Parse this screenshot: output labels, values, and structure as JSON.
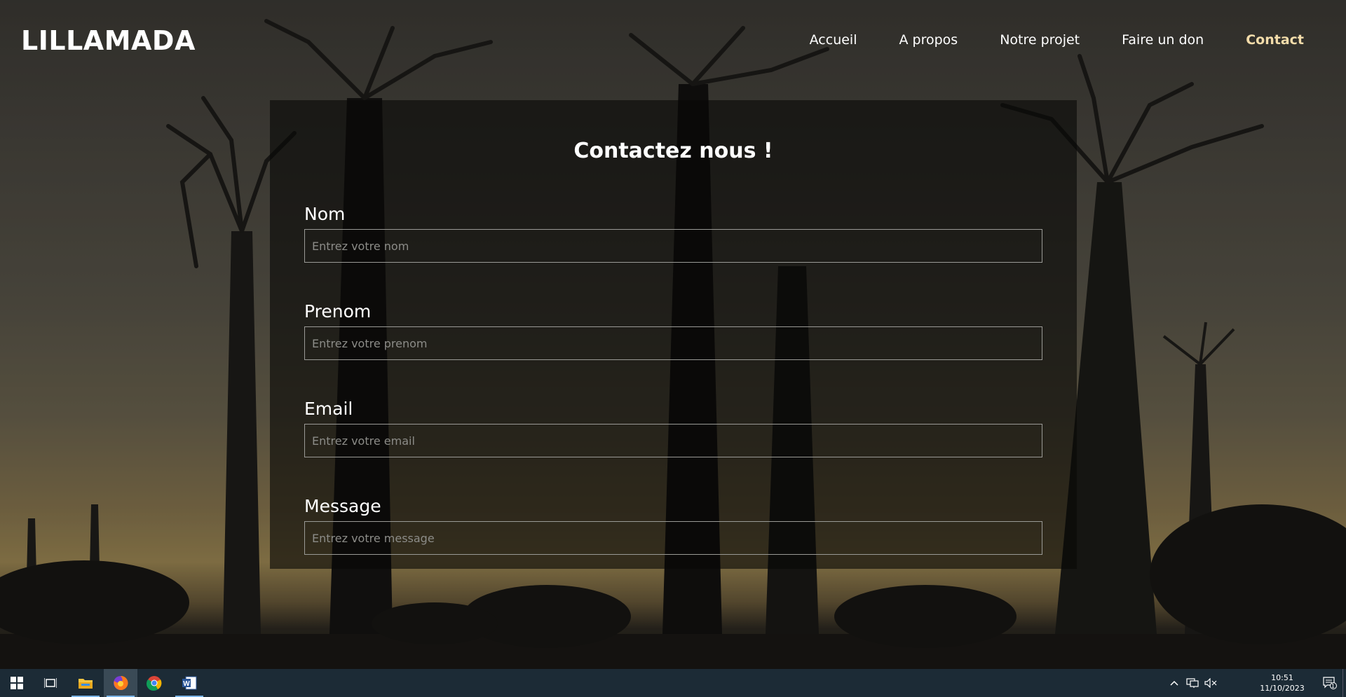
{
  "site": {
    "brand": "LILLAMADA",
    "nav": [
      {
        "label": "Accueil",
        "active": false
      },
      {
        "label": "A propos",
        "active": false
      },
      {
        "label": "Notre projet",
        "active": false
      },
      {
        "label": "Faire un don",
        "active": false
      },
      {
        "label": "Contact",
        "active": true
      }
    ]
  },
  "form": {
    "title": "Contactez nous !",
    "fields": [
      {
        "label": "Nom",
        "placeholder": "Entrez votre nom",
        "value": ""
      },
      {
        "label": "Prenom",
        "placeholder": "Entrez votre prenom",
        "value": ""
      },
      {
        "label": "Email",
        "placeholder": "Entrez votre email",
        "value": ""
      },
      {
        "label": "Message",
        "placeholder": "Entrez votre message",
        "value": ""
      }
    ]
  },
  "taskbar": {
    "apps": [
      {
        "icon": "windows-start-icon",
        "running": false,
        "focused": false
      },
      {
        "icon": "task-view-icon",
        "running": false,
        "focused": false
      },
      {
        "icon": "file-explorer-icon",
        "running": true,
        "focused": false
      },
      {
        "icon": "firefox-icon",
        "running": true,
        "focused": true
      },
      {
        "icon": "chrome-icon",
        "running": false,
        "focused": false
      },
      {
        "icon": "word-icon",
        "running": true,
        "focused": false
      }
    ],
    "tray": {
      "icons": [
        "chevron-up-icon",
        "network-icon",
        "volume-muted-icon"
      ],
      "time": "10:51",
      "date": "11/10/2023",
      "notification_count": "1"
    }
  },
  "colors": {
    "accent_nav_active": "#f3dcaa",
    "taskbar_bg": "#1c2b36",
    "panel_bg": "rgba(8,8,6,0.62)"
  }
}
